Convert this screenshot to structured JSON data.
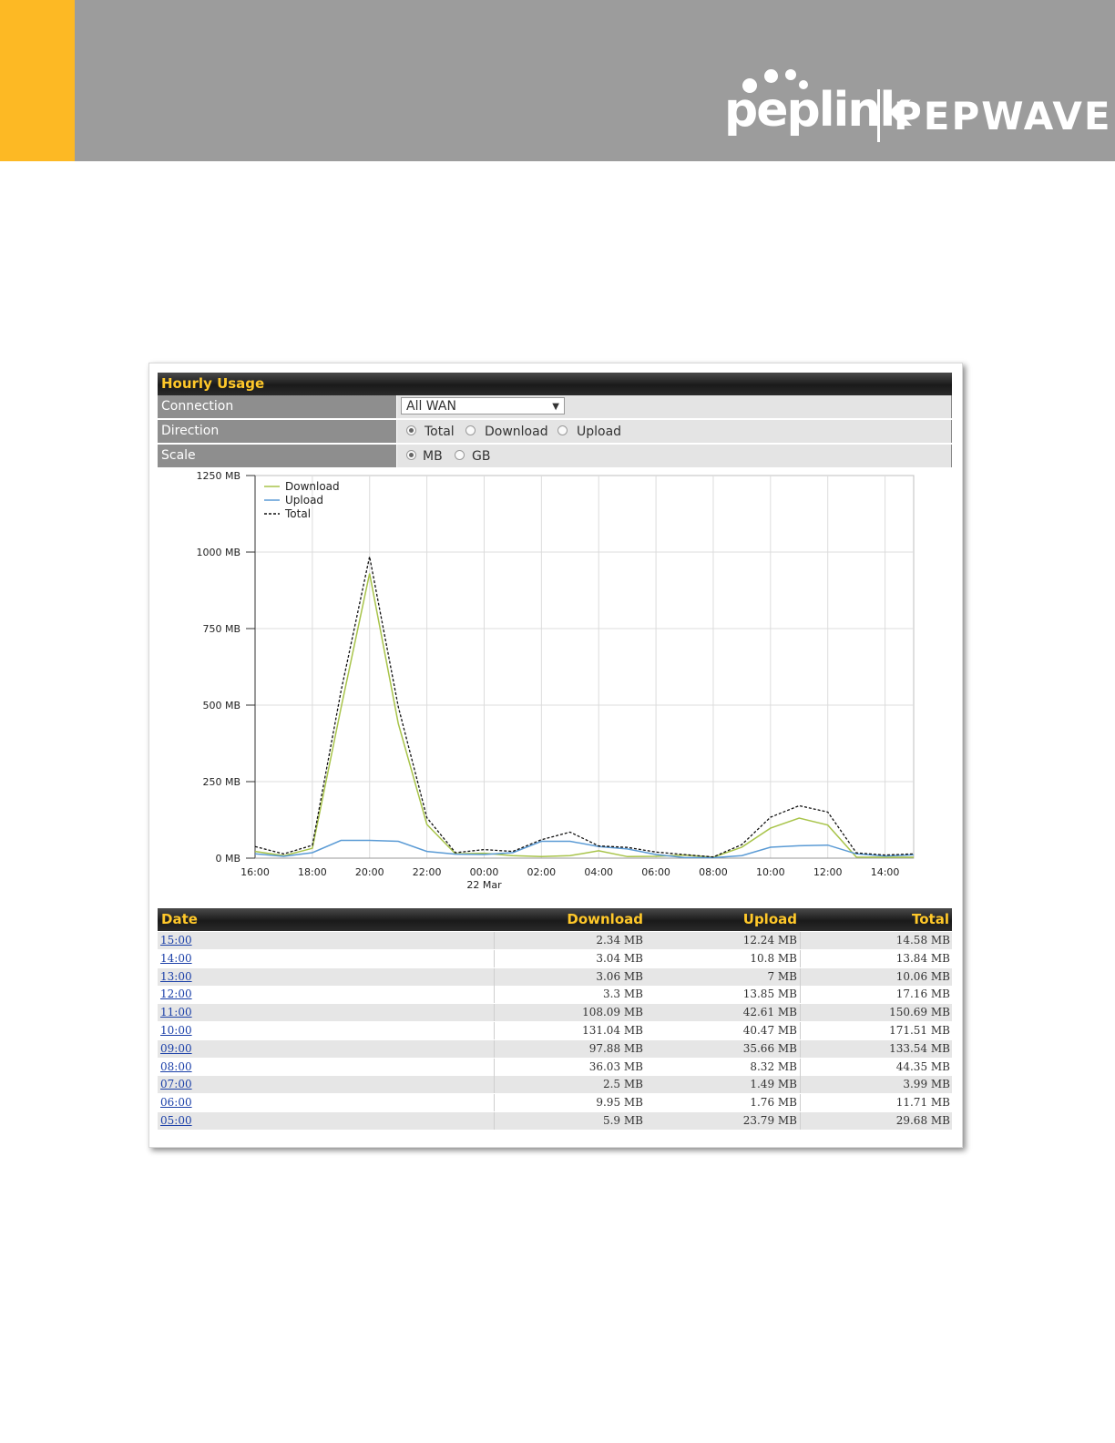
{
  "brand": {
    "name": "peplink",
    "product": "PEPWAVE",
    "accent": "#fdb924",
    "banner_color": "#9c9c9c"
  },
  "panel": {
    "title": "Hourly Usage",
    "connection": {
      "label": "Connection",
      "selected": "All WAN"
    },
    "direction": {
      "label": "Direction",
      "options": [
        "Total",
        "Download",
        "Upload"
      ],
      "selected": "Total"
    },
    "scale": {
      "label": "Scale",
      "options": [
        "MB",
        "GB"
      ],
      "selected": "MB"
    }
  },
  "chart_data": {
    "type": "line",
    "y_ticks": [
      "1250 MB",
      "1000 MB",
      "750 MB",
      "500 MB",
      "250 MB",
      "0 MB"
    ],
    "ylim": [
      0,
      1250
    ],
    "x_ticks": [
      "16:00",
      "18:00",
      "20:00",
      "22:00",
      "00:00",
      "02:00",
      "04:00",
      "06:00",
      "08:00",
      "10:00",
      "12:00",
      "14:00"
    ],
    "x_date_label": "22 Mar",
    "grid": true,
    "legend_position": "top-left",
    "colors": {
      "Download": "#a8c44a",
      "Upload": "#5b9bd5",
      "Total": "#111111"
    },
    "x": [
      0,
      1,
      2,
      3,
      4,
      5,
      6,
      7,
      8,
      9,
      10,
      11,
      12,
      13,
      14,
      15,
      16,
      17,
      18,
      19,
      20,
      21,
      22,
      23
    ],
    "series": [
      {
        "name": "Download",
        "style": "solid",
        "values": [
          22,
          8,
          32,
          490,
          930,
          440,
          110,
          14,
          16,
          8,
          5,
          8,
          24,
          5,
          6,
          10,
          3,
          36,
          98,
          131,
          108,
          3.3,
          3.06,
          3.04
        ]
      },
      {
        "name": "Upload",
        "style": "solid",
        "values": [
          14,
          6,
          18,
          58,
          58,
          55,
          22,
          13,
          12,
          18,
          55,
          55,
          38,
          30,
          12,
          1.76,
          1.49,
          8.32,
          35.66,
          40.47,
          42.61,
          13.85,
          7,
          10.8
        ]
      },
      {
        "name": "Total",
        "style": "dashed",
        "values": [
          38,
          14,
          42,
          545,
          985,
          495,
          132,
          18,
          28,
          22,
          60,
          85,
          40,
          35,
          20,
          11.71,
          3.99,
          44.35,
          133.54,
          171.51,
          150.69,
          17.16,
          10.06,
          13.84
        ]
      }
    ]
  },
  "table": {
    "headers": {
      "date": "Date",
      "download": "Download",
      "upload": "Upload",
      "total": "Total"
    },
    "rows": [
      {
        "date": "15:00",
        "download": "2.34 MB",
        "upload": "12.24 MB",
        "total": "14.58 MB"
      },
      {
        "date": "14:00",
        "download": "3.04 MB",
        "upload": "10.8 MB",
        "total": "13.84 MB"
      },
      {
        "date": "13:00",
        "download": "3.06 MB",
        "upload": "7 MB",
        "total": "10.06 MB"
      },
      {
        "date": "12:00",
        "download": "3.3 MB",
        "upload": "13.85 MB",
        "total": "17.16 MB"
      },
      {
        "date": "11:00",
        "download": "108.09 MB",
        "upload": "42.61 MB",
        "total": "150.69 MB"
      },
      {
        "date": "10:00",
        "download": "131.04 MB",
        "upload": "40.47 MB",
        "total": "171.51 MB"
      },
      {
        "date": "09:00",
        "download": "97.88 MB",
        "upload": "35.66 MB",
        "total": "133.54 MB"
      },
      {
        "date": "08:00",
        "download": "36.03 MB",
        "upload": "8.32 MB",
        "total": "44.35 MB"
      },
      {
        "date": "07:00",
        "download": "2.5 MB",
        "upload": "1.49 MB",
        "total": "3.99 MB"
      },
      {
        "date": "06:00",
        "download": "9.95 MB",
        "upload": "1.76 MB",
        "total": "11.71 MB"
      },
      {
        "date": "05:00",
        "download": "5.9 MB",
        "upload": "23.79 MB",
        "total": "29.68 MB"
      }
    ]
  }
}
